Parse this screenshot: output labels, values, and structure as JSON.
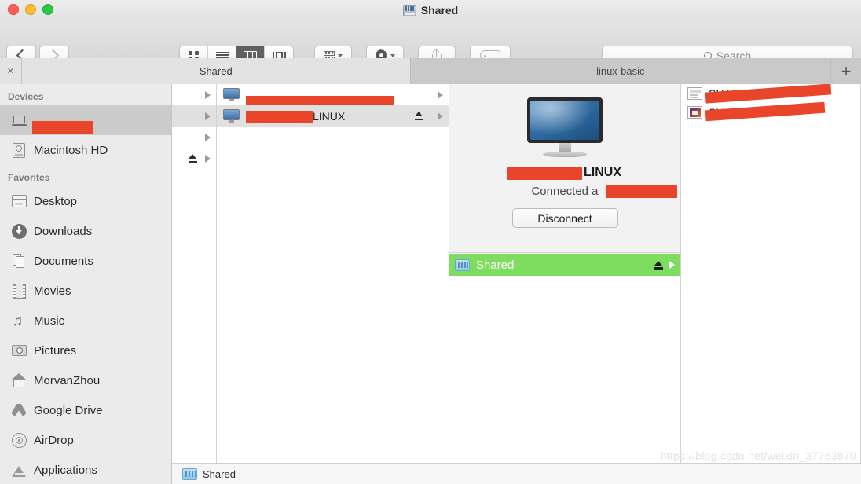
{
  "window": {
    "title": "Shared",
    "title_icon": "shared-drive-icon"
  },
  "toolbar": {
    "back_icon": "chevron-left-icon",
    "forward_icon": "chevron-right-icon",
    "view_modes": [
      {
        "name": "icon-view",
        "icon": "grid-icon",
        "active": false
      },
      {
        "name": "list-view",
        "icon": "list-icon",
        "active": false
      },
      {
        "name": "column-view",
        "icon": "columns-icon",
        "active": true
      },
      {
        "name": "gallery-view",
        "icon": "gallery-icon",
        "active": false
      }
    ],
    "arrange_icon": "arrange-icon",
    "action_icon": "gear-icon",
    "share_icon": "share-icon",
    "tag_icon": "tag-icon",
    "dropdown_icon": "chevron-down-icon"
  },
  "search": {
    "placeholder": "Search",
    "value": "",
    "icon": "search-icon"
  },
  "tabs": {
    "close_label": "×",
    "add_label": "+",
    "items": [
      {
        "label": "Shared",
        "active": true
      },
      {
        "label": "linux-basic",
        "active": false
      }
    ]
  },
  "sidebar": {
    "sections": [
      {
        "header": "Devices",
        "items": [
          {
            "label": "",
            "icon": "laptop-icon",
            "selected": true,
            "redacted": true
          },
          {
            "label": "Macintosh HD",
            "icon": "hard-drive-icon",
            "selected": false,
            "redacted": false
          }
        ]
      },
      {
        "header": "Favorites",
        "items": [
          {
            "label": "Desktop",
            "icon": "desktop-icon",
            "selected": false,
            "redacted": false
          },
          {
            "label": "Downloads",
            "icon": "downloads-icon",
            "selected": false,
            "redacted": false
          },
          {
            "label": "Documents",
            "icon": "documents-icon",
            "selected": false,
            "redacted": false
          },
          {
            "label": "Movies",
            "icon": "movies-icon",
            "selected": false,
            "redacted": false
          },
          {
            "label": "Music",
            "icon": "music-icon",
            "selected": false,
            "redacted": false
          },
          {
            "label": "Pictures",
            "icon": "pictures-icon",
            "selected": false,
            "redacted": false
          },
          {
            "label": "MorvanZhou",
            "icon": "home-icon",
            "selected": false,
            "redacted": false
          },
          {
            "label": "Google Drive",
            "icon": "google-drive-icon",
            "selected": false,
            "redacted": false
          },
          {
            "label": "AirDrop",
            "icon": "airdrop-icon",
            "selected": false,
            "redacted": false
          },
          {
            "label": "Applications",
            "icon": "applications-icon",
            "selected": false,
            "redacted": false
          }
        ]
      }
    ]
  },
  "columns": {
    "column1": {
      "rows": [
        {
          "disclosure": true,
          "eject": false,
          "selected": false
        },
        {
          "disclosure": true,
          "eject": false,
          "selected": true
        },
        {
          "disclosure": true,
          "eject": false,
          "selected": false
        },
        {
          "disclosure": true,
          "eject": true,
          "selected": false
        }
      ]
    },
    "column2": {
      "rows": [
        {
          "name": "",
          "icon": "monitor-icon",
          "selected": false,
          "eject": false,
          "disclosure": true
        },
        {
          "name": "LINUX",
          "icon": "monitor-icon",
          "selected": true,
          "eject": true,
          "disclosure": true
        }
      ]
    },
    "preview": {
      "icon": "imac-display-icon",
      "device_name": "LINUX",
      "status_text": "Connected a",
      "disconnect_label": "Disconnect",
      "shared_row": {
        "label": "Shared",
        "icon": "shared-folder-icon",
        "eject_icon": "eject-icon",
        "disclosure_icon": "chevron-right-icon",
        "highlight_color": "#7edc5f"
      }
    },
    "column4": {
      "rows": [
        {
          "name": "SHA0A0 7.PNG",
          "icon": "document-preview-icon",
          "redacted": true
        },
        {
          "name": "SHOT 4.PNG",
          "icon": "image-preview-icon",
          "redacted": true
        }
      ]
    }
  },
  "pathbar": {
    "label": "Shared",
    "icon": "shared-folder-icon"
  },
  "watermark": "https://blog.csdn.net/weixin_37763870",
  "colors": {
    "redaction": "#e8452a",
    "shared_highlight": "#7edc5f",
    "selection_gray": "#cbcbcb"
  }
}
